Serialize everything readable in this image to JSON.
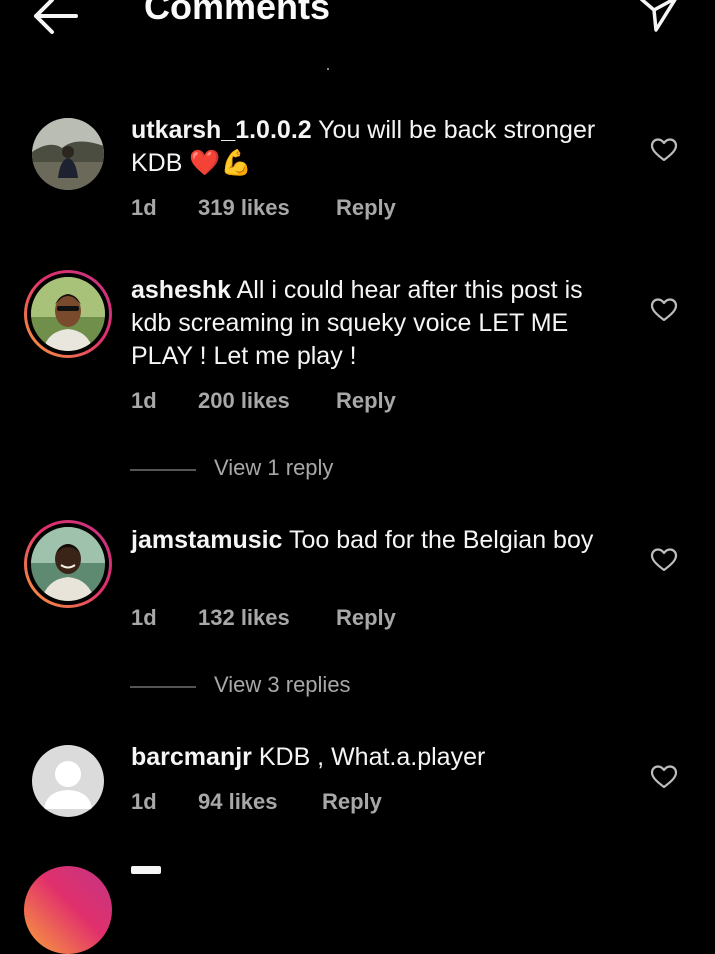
{
  "header": {
    "title": "Comments"
  },
  "comments": [
    {
      "username": "utkarsh_1.0.0.2",
      "text_before": " You will be back stronger KDB ",
      "emoji_heart": "❤️",
      "emoji_flex": "💪",
      "time": "1d",
      "likes": "319 likes",
      "reply": "Reply"
    },
    {
      "username": "asheshk",
      "text": " All i could hear after this post is kdb screaming in squeky voice LET ME PLAY ! Let me play !",
      "time": "1d",
      "likes": "200 likes",
      "reply": "Reply",
      "view_replies": "View 1 reply"
    },
    {
      "username": "jamstamusic",
      "text": " Too bad for the Belgian boy",
      "time": "1d",
      "likes": "132 likes",
      "reply": "Reply",
      "view_replies": "View 3 replies"
    },
    {
      "username": "barcmanjr",
      "text": " KDB , What.a.player",
      "time": "1d",
      "likes": "94 likes",
      "reply": "Reply"
    }
  ],
  "icons": {
    "back": "arrow-left-icon",
    "send": "send-icon",
    "like": "heart-outline-icon",
    "default_avatar": "default-avatar-icon"
  },
  "colors": {
    "background": "#000000",
    "text": "#f5f5f5",
    "secondary_text": "#a8a8a8",
    "story_ring_start": "#f9a23a",
    "story_ring_end": "#c13584"
  }
}
